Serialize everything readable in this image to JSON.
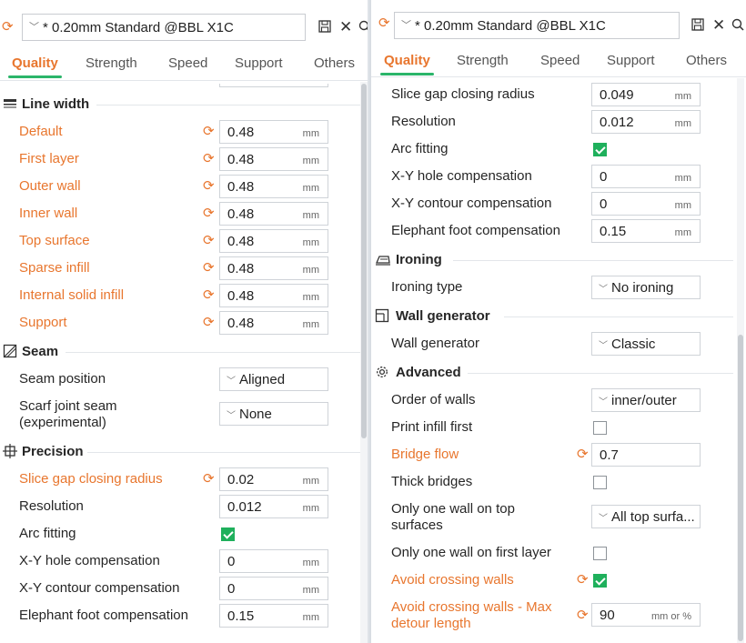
{
  "accent": "#e8762e",
  "check_color": "#1fb05c",
  "left": {
    "preset": "* 0.20mm Standard @BBL X1C",
    "tabs": [
      "Quality",
      "Strength",
      "Speed",
      "Support",
      "Others"
    ],
    "line_width": {
      "title": "Line width",
      "rows": [
        {
          "label": "Default",
          "value": "0.48",
          "unit": "mm"
        },
        {
          "label": "First layer",
          "value": "0.48",
          "unit": "mm"
        },
        {
          "label": "Outer wall",
          "value": "0.48",
          "unit": "mm"
        },
        {
          "label": "Inner wall",
          "value": "0.48",
          "unit": "mm"
        },
        {
          "label": "Top surface",
          "value": "0.48",
          "unit": "mm"
        },
        {
          "label": "Sparse infill",
          "value": "0.48",
          "unit": "mm"
        },
        {
          "label": "Internal solid infill",
          "value": "0.48",
          "unit": "mm"
        },
        {
          "label": "Support",
          "value": "0.48",
          "unit": "mm"
        }
      ]
    },
    "seam": {
      "title": "Seam",
      "seam_position": {
        "label": "Seam position",
        "value": "Aligned"
      },
      "scarf_joint": {
        "label": "Scarf joint seam (experimental)",
        "value": "None"
      }
    },
    "precision": {
      "title": "Precision",
      "slice_gap": {
        "label": "Slice gap closing radius",
        "value": "0.02",
        "unit": "mm"
      },
      "resolution": {
        "label": "Resolution",
        "value": "0.012",
        "unit": "mm"
      },
      "arc_fitting": {
        "label": "Arc fitting",
        "checked": true
      },
      "xy_hole": {
        "label": "X-Y hole compensation",
        "value": "0",
        "unit": "mm"
      },
      "xy_contour": {
        "label": "X-Y contour compensation",
        "value": "0",
        "unit": "mm"
      },
      "elephant": {
        "label": "Elephant foot compensation",
        "value": "0.15",
        "unit": "mm"
      }
    }
  },
  "right": {
    "preset": "* 0.20mm Standard @BBL X1C",
    "tabs": [
      "Quality",
      "Strength",
      "Speed",
      "Support",
      "Others"
    ],
    "precision": {
      "slice_gap": {
        "label": "Slice gap closing radius",
        "value": "0.049",
        "unit": "mm"
      },
      "resolution": {
        "label": "Resolution",
        "value": "0.012",
        "unit": "mm"
      },
      "arc_fitting": {
        "label": "Arc fitting",
        "checked": true
      },
      "xy_hole": {
        "label": "X-Y hole compensation",
        "value": "0",
        "unit": "mm"
      },
      "xy_contour": {
        "label": "X-Y contour compensation",
        "value": "0",
        "unit": "mm"
      },
      "elephant": {
        "label": "Elephant foot compensation",
        "value": "0.15",
        "unit": "mm"
      }
    },
    "ironing": {
      "title": "Ironing",
      "type": {
        "label": "Ironing type",
        "value": "No ironing"
      }
    },
    "wall_generator": {
      "title": "Wall generator",
      "row": {
        "label": "Wall generator",
        "value": "Classic"
      }
    },
    "advanced": {
      "title": "Advanced",
      "order_of_walls": {
        "label": "Order of walls",
        "value": "inner/outer"
      },
      "print_infill_first": {
        "label": "Print infill first",
        "checked": false
      },
      "bridge_flow": {
        "label": "Bridge flow",
        "value": "0.7"
      },
      "thick_bridges": {
        "label": "Thick bridges",
        "checked": false
      },
      "one_wall_top": {
        "label": "Only one wall on top surfaces",
        "value": "All top surfa..."
      },
      "one_wall_first": {
        "label": "Only one wall on first layer",
        "checked": false
      },
      "avoid_crossing": {
        "label": "Avoid crossing walls",
        "checked": true
      },
      "avoid_crossing_max": {
        "label": "Avoid crossing walls - Max detour length",
        "value": "90",
        "unit": "mm or %"
      }
    }
  }
}
